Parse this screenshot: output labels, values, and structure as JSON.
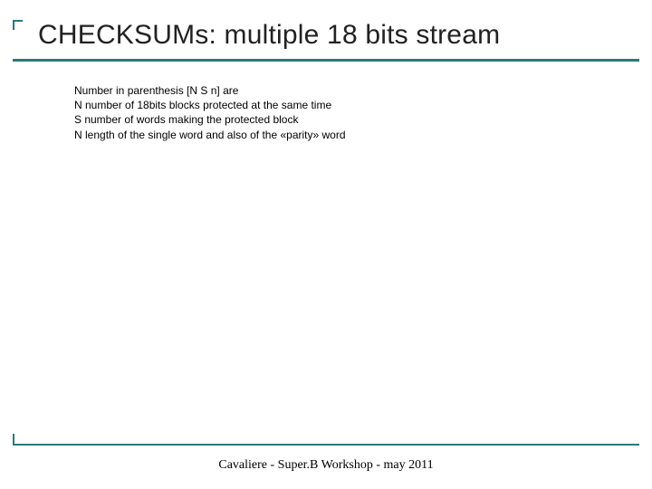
{
  "title": "CHECKSUMs: multiple 18 bits stream",
  "body": {
    "line1": "Number in parenthesis [N S n] are",
    "line2": "N number of 18bits blocks protected at the same time",
    "line3": "S number of words making the protected block",
    "line4": "N length of the single word and also of the «parity» word"
  },
  "footer": "Cavaliere - Super.B Workshop - may 2011"
}
